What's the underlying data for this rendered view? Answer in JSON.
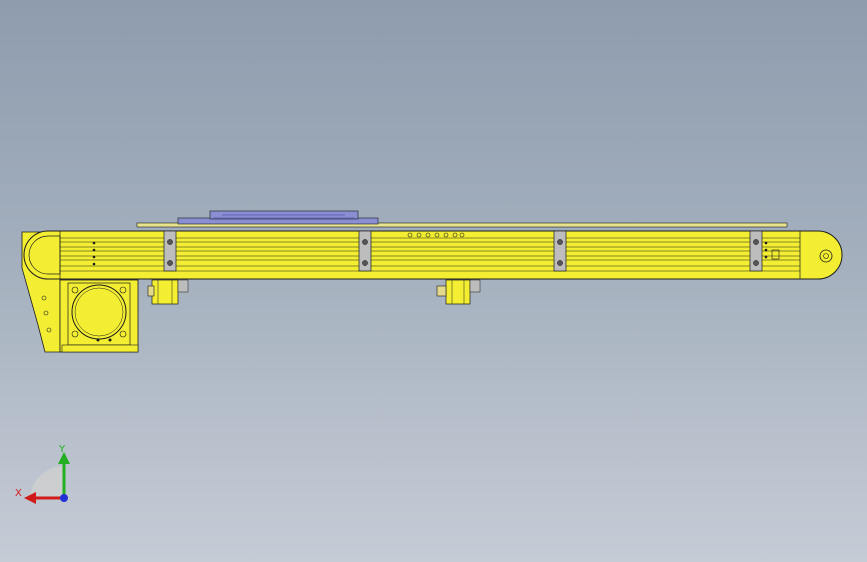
{
  "viewport": {
    "background_top": "#8e9cae",
    "background_bottom": "#c6ccd6"
  },
  "model": {
    "part_color": "#f3ee32",
    "edge_color": "#1c1c1c",
    "bracket_color": "#bdbdbd",
    "top_plate_color": "#8a8fd4"
  },
  "triad": {
    "x_label": "X",
    "y_label": "Y",
    "x_color": "#d11a1a",
    "y_color": "#22b022",
    "z_color": "#2230d6"
  }
}
